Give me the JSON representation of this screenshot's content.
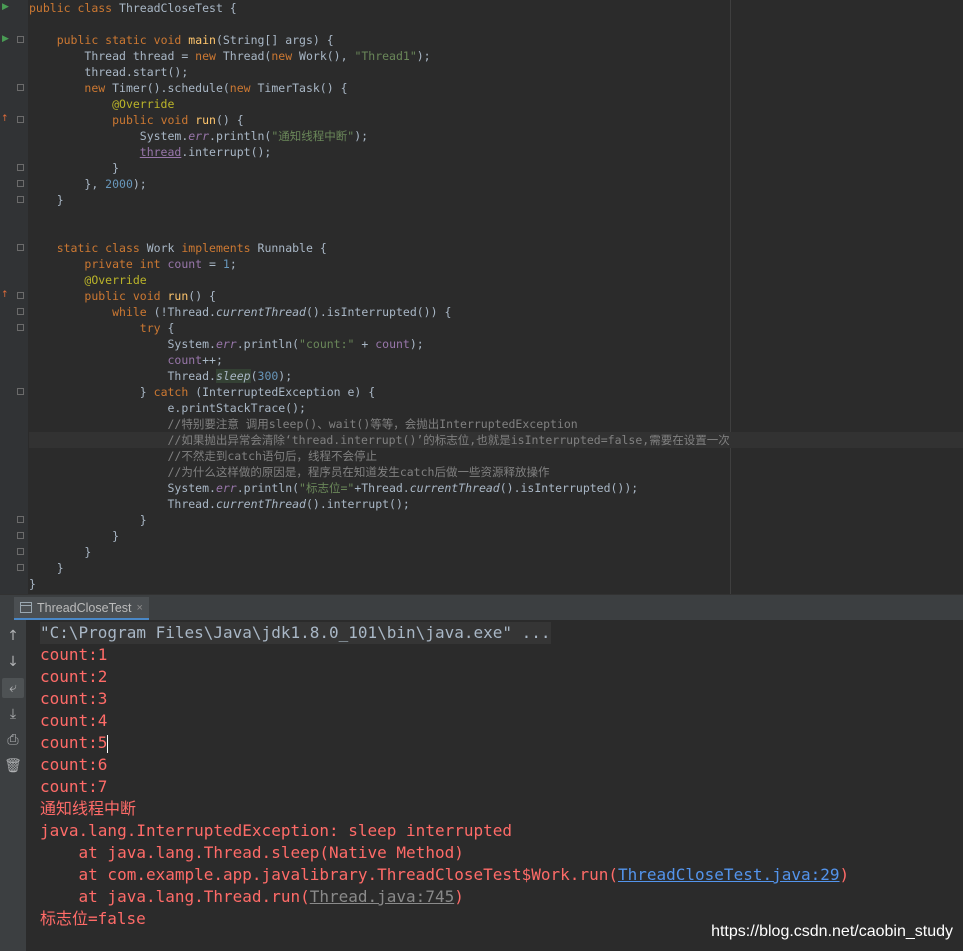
{
  "editor": {
    "code": {
      "l1": {
        "kw1": "public ",
        "kw2": "class ",
        "name": "ThreadCloseTest {"
      },
      "l3": {
        "kw1": "public ",
        "kw2": "static ",
        "kw3": "void ",
        "fn": "main",
        "rest": "(String[] args) {"
      },
      "l4": {
        "a": "Thread thread = ",
        "kw": "new ",
        "b": "Thread(",
        "kw2": "new ",
        "c": "Work(), ",
        "str": "\"Thread1\"",
        "d": ");"
      },
      "l5": {
        "a": "thread.start();"
      },
      "l6": {
        "kw": "new ",
        "a": "Timer().schedule(",
        "kw2": "new ",
        "b": "TimerTask() {"
      },
      "l7": {
        "ann": "@Override"
      },
      "l8": {
        "kw1": "public ",
        "kw2": "void ",
        "fn": "run",
        "rest": "() {"
      },
      "l9": {
        "a": "System.",
        "fld": "err",
        "b": ".println(",
        "str": "\"通知线程中断\"",
        "c": ");"
      },
      "l10": {
        "fld": "thread",
        "a": ".interrupt();"
      },
      "l11": {
        "a": "}"
      },
      "l12": {
        "a": "}, ",
        "num": "2000",
        "b": ");"
      },
      "l13": {
        "a": "}"
      },
      "l16": {
        "kw1": "static ",
        "kw2": "class ",
        "a": "Work ",
        "kw3": "implements ",
        "b": "Runnable {"
      },
      "l17": {
        "kw1": "private ",
        "kw2": "int ",
        "fld": "count",
        "a": " = ",
        "num": "1",
        "b": ";"
      },
      "l18": {
        "ann": "@Override"
      },
      "l19": {
        "kw1": "public ",
        "kw2": "void ",
        "fn": "run",
        "rest": "() {"
      },
      "l20": {
        "kw": "while ",
        "a": "(!Thread.",
        "mi": "currentThread",
        "b": "().isInterrupted()) {"
      },
      "l21": {
        "kw": "try ",
        "a": "{"
      },
      "l22": {
        "a": "System.",
        "fld": "err",
        "b": ".println(",
        "str": "\"count:\"",
        "c": " + ",
        "fld2": "count",
        "d": ");"
      },
      "l23": {
        "fld": "count",
        "a": "++;"
      },
      "l24": {
        "a": "Thread.",
        "mi": "sleep",
        "b": "(",
        "num": "300",
        "c": ");"
      },
      "l25": {
        "a": "} ",
        "kw": "catch ",
        "b": "(InterruptedException e) {"
      },
      "l26": {
        "a": "e.printStackTrace();"
      },
      "l27": {
        "cmt": "//特别要注意 调用sleep()、wait()等等，会抛出InterruptedException"
      },
      "l28": {
        "cmt": "//如果抛出异常会清除‘thread.interrupt()’的标志位,也就是isInterrupted=false,需要在设置一次"
      },
      "l29": {
        "cmt": "//不然走到catch语句后，线程不会停止"
      },
      "l30": {
        "cmt": "//为什么这样做的原因是，程序员在知道发生catch后做一些资源释放操作"
      },
      "l31": {
        "a": "System.",
        "fld": "err",
        "b": ".println(",
        "str": "\"标志位=\"",
        "c": "+Thread.",
        "mi": "currentThread",
        "d": "().isInterrupted());"
      },
      "l32": {
        "a": "Thread.",
        "mi": "currentThread",
        "b": "().interrupt();"
      },
      "l33": {
        "a": "}"
      },
      "l34": {
        "a": "}"
      },
      "l35": {
        "a": "}"
      },
      "l36": {
        "a": "}"
      },
      "l37": {
        "a": "}"
      }
    },
    "gutter_icons": {
      "run": "▶",
      "override": "↑"
    }
  },
  "console": {
    "tab_label": "ThreadCloseTest",
    "tab_close": "×",
    "toolbar": {
      "up": "↑",
      "down": "↓",
      "wrap": "⤶",
      "scroll_end": "⤓",
      "print": "⎙",
      "trash": "🗑"
    },
    "command": "\"C:\\Program Files\\Java\\jdk1.8.0_101\\bin\\java.exe\" ...",
    "lines": {
      "c1": "count:1",
      "c2": "count:2",
      "c3": "count:3",
      "c4": "count:4",
      "c5": "count:5",
      "c6": "count:6",
      "c7": "count:7",
      "notify": "通知线程中断",
      "exc": "java.lang.InterruptedException: sleep interrupted",
      "at1": "    at java.lang.Thread.sleep(Native Method)",
      "at2_pre": "    at com.example.app.javalibrary.ThreadCloseTest$Work.run(",
      "at2_link": "ThreadCloseTest.java:29",
      "at2_post": ")",
      "at3_pre": "    at java.lang.Thread.run(",
      "at3_link": "Thread.java:745",
      "at3_post": ")",
      "flag": "标志位=false"
    }
  },
  "watermark": "https://blog.csdn.net/caobin_study"
}
